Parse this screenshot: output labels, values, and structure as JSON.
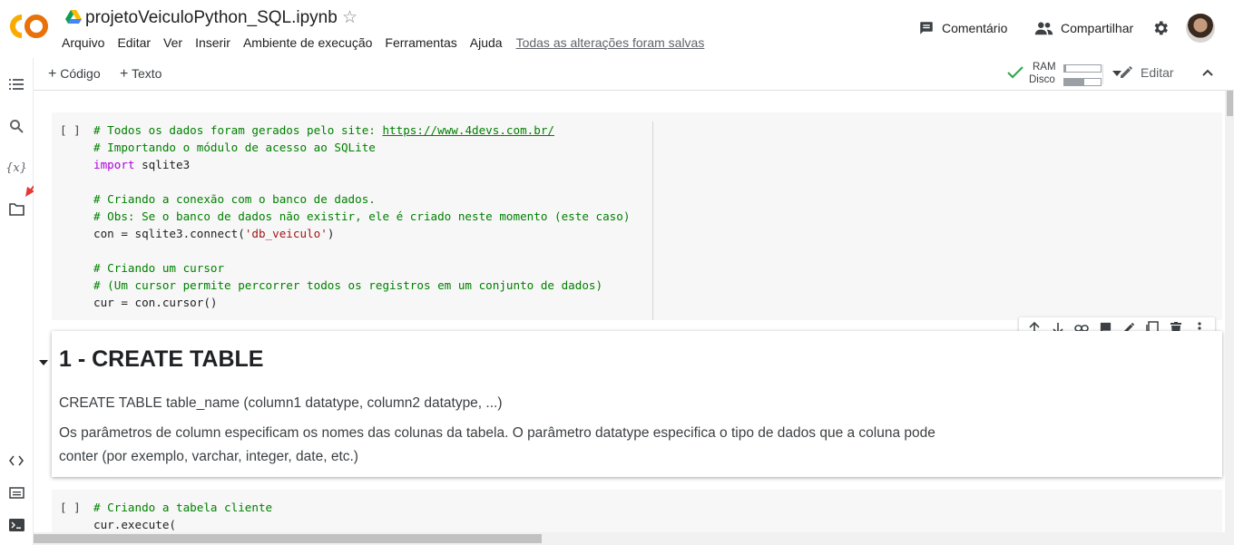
{
  "header": {
    "notebook_title": "projetoVeiculoPython_SQL.ipynb",
    "logo_text": "CO",
    "menu": [
      "Arquivo",
      "Editar",
      "Ver",
      "Inserir",
      "Ambiente de execução",
      "Ferramentas",
      "Ajuda"
    ],
    "save_status": "Todas as alterações foram salvas",
    "comment_label": "Comentário",
    "share_label": "Compartilhar"
  },
  "toolbar": {
    "add_code_label": "Código",
    "add_text_label": "Texto",
    "ram_label": "RAM",
    "disk_label": "Disco",
    "ram_usage": 0.05,
    "disk_usage": 0.55,
    "edit_label": "Editar"
  },
  "left_rail": {
    "icons": [
      "toc-icon",
      "search-icon",
      "variables-icon",
      "folder-icon",
      "code-snippets-icon",
      "command-palette-icon",
      "terminal-icon"
    ]
  },
  "cell1": {
    "run_indicator": "[ ]",
    "lines": [
      {
        "parts": [
          {
            "t": "# Todos os dados foram gerados pelo site: ",
            "c": "cm"
          },
          {
            "t": "https://www.4devs.com.br/",
            "c": "lnk"
          }
        ]
      },
      {
        "parts": [
          {
            "t": "# Importando o módulo de acesso ao SQLite",
            "c": "cm"
          }
        ]
      },
      {
        "parts": [
          {
            "t": "import",
            "c": "kw"
          },
          {
            "t": " sqlite3",
            "c": ""
          }
        ]
      },
      {
        "parts": []
      },
      {
        "parts": [
          {
            "t": "# Criando a conexão com o banco de dados.",
            "c": "cm"
          }
        ]
      },
      {
        "parts": [
          {
            "t": "# Obs: Se o banco de dados não existir, ele é criado neste momento (este caso)",
            "c": "cm"
          }
        ]
      },
      {
        "parts": [
          {
            "t": "con = sqlite3.connect(",
            "c": ""
          },
          {
            "t": "'db_veiculo'",
            "c": "st"
          },
          {
            "t": ")",
            "c": ""
          }
        ]
      },
      {
        "parts": []
      },
      {
        "parts": [
          {
            "t": "# Criando um cursor",
            "c": "cm"
          }
        ]
      },
      {
        "parts": [
          {
            "t": "# (Um cursor permite percorrer todos os registros em um conjunto de dados)",
            "c": "cm"
          }
        ]
      },
      {
        "parts": [
          {
            "t": "cur = con.cursor()",
            "c": ""
          }
        ]
      }
    ]
  },
  "markdown_cell": {
    "heading": "1 - CREATE TABLE",
    "p1": "CREATE TABLE table_name (column1 datatype, column2 datatype, ...)",
    "p2_line1": "Os parâmetros de column especificam os nomes das colunas da tabela. O parâmetro datatype especifica o tipo de dados que a coluna pode",
    "p2_line2": "conter (por exemplo, varchar, integer, date, etc.)"
  },
  "cell2": {
    "run_indicator": "[ ]",
    "lines": [
      {
        "parts": [
          {
            "t": "# Criando a tabela cliente",
            "c": "cm"
          }
        ]
      },
      {
        "parts": [
          {
            "t": "cur.execute(",
            "c": ""
          }
        ]
      }
    ]
  },
  "colors": {
    "comment": "#008000",
    "keyword": "#af00db",
    "string": "#a31515",
    "logo_orange": "#F9AB00",
    "logo_dark": "#E8710A",
    "check_green": "#34a853",
    "annotation_arrow": "#e53935"
  }
}
